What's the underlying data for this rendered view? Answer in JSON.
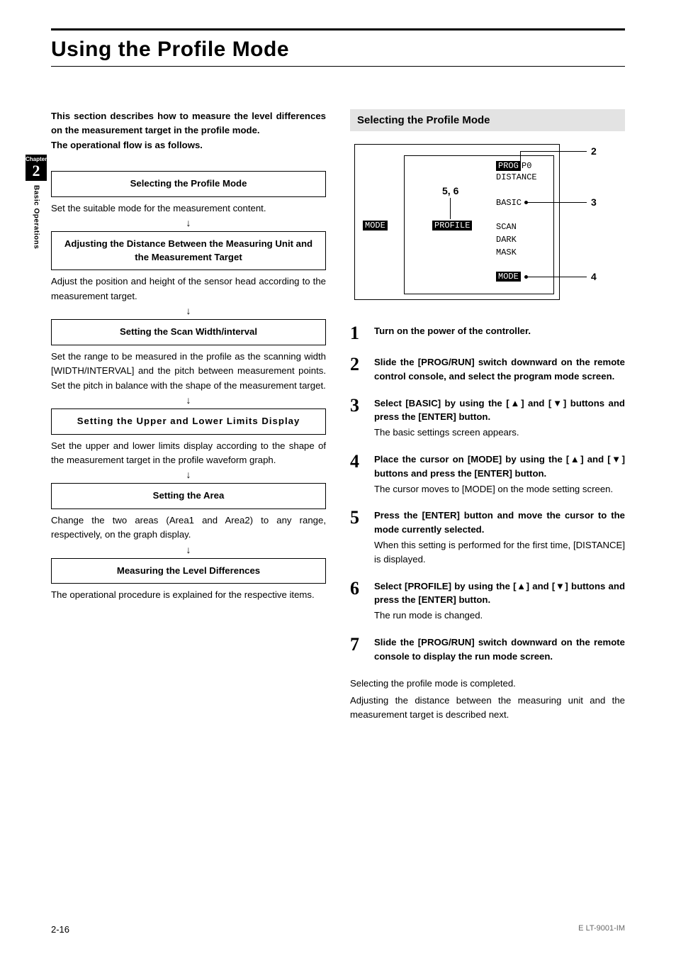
{
  "title": "Using the Profile Mode",
  "sideTab": {
    "chapter": "Chapter",
    "num": "2",
    "text": "Basic Operations"
  },
  "intro": "This section describes how to measure the level differences on the measurement target in the profile mode.",
  "introFollow": "The operational flow is as follows.",
  "flow": [
    {
      "box": "Selecting the Profile Mode",
      "desc": "Set the suitable mode for the measurement content."
    },
    {
      "box": "Adjusting the Distance Between the Measuring Unit and the Measurement Target",
      "desc": "Adjust the position and height of the sensor head according to the measurement target."
    },
    {
      "box": "Setting the Scan Width/interval",
      "desc": "Set the range to be measured in the profile as the scanning width [WIDTH/INTERVAL] and the pitch between measurement points. Set the pitch in balance with the shape of the measurement target."
    },
    {
      "box": "Setting the Upper and Lower Limits Display",
      "desc": "Set the upper and lower limits display according to the shape of the measurement target in the profile waveform graph."
    },
    {
      "box": "Setting the Area",
      "desc": "Change the two areas (Area1 and Area2) to any range, respectively, on the graph display."
    },
    {
      "box": "Measuring the Level Differences",
      "desc": "The operational procedure is explained for the respective items."
    }
  ],
  "arrow": "↓",
  "sectionHead": "Selecting the Profile Mode",
  "diagram": {
    "prog": "PROG",
    "p0": "P0",
    "distance": "DISTANCE",
    "basic": "BASIC",
    "scan": "SCAN",
    "dark": "DARK",
    "mask": "MASK",
    "modeTop": "MODE",
    "modeLeft": "MODE",
    "profile": "PROFILE",
    "c2": "2",
    "c3": "3",
    "c4": "4",
    "c56": "5, 6"
  },
  "steps": [
    {
      "n": "1",
      "bold": "Turn on the power of the controller.",
      "plain": ""
    },
    {
      "n": "2",
      "bold": "Slide the [PROG/RUN] switch downward on the remote control console, and select the program mode screen.",
      "plain": ""
    },
    {
      "n": "3",
      "bold": "Select [BASIC] by using the [▲] and [▼] buttons and press the [ENTER] button.",
      "plain": "The basic settings screen appears."
    },
    {
      "n": "4",
      "bold": "Place the cursor on [MODE] by using the [▲] and [▼] buttons and press the [ENTER] button.",
      "plain": "The cursor moves to [MODE] on the mode setting screen."
    },
    {
      "n": "5",
      "bold": "Press the [ENTER] button and move the cursor to the mode currently selected.",
      "plain": "When this setting is performed for the first time, [DISTANCE] is displayed."
    },
    {
      "n": "6",
      "bold": "Select [PROFILE] by using the [▲] and [▼] buttons and press the [ENTER] button.",
      "plain": "The run mode is changed."
    },
    {
      "n": "7",
      "bold": "Slide the [PROG/RUN] switch downward on the remote console to display the run mode screen.",
      "plain": ""
    }
  ],
  "closing1": "Selecting the profile mode is completed.",
  "closing2": "Adjusting the distance between the measuring unit and the measurement target is described next.",
  "footer": {
    "page": "2-16",
    "doc": "E LT-9001-IM"
  }
}
